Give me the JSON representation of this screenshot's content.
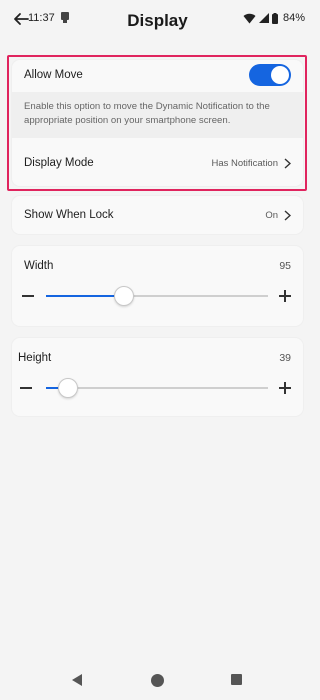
{
  "status_bar": {
    "time": "11:37",
    "battery": "84%"
  },
  "header": {
    "title": "Display"
  },
  "allow_move": {
    "label": "Allow Move",
    "enabled": true,
    "description": "Enable this option to move the Dynamic Notification to the appropriate position on your smartphone screen."
  },
  "display_mode": {
    "label": "Display Mode",
    "value": "Has Notification"
  },
  "show_when_lock": {
    "label": "Show When Lock",
    "value": "On"
  },
  "width_slider": {
    "label": "Width",
    "value": "95",
    "fraction": 0.35
  },
  "height_slider": {
    "label": "Height",
    "value": "39",
    "fraction": 0.1
  },
  "colors": {
    "accent": "#1565e0",
    "highlight": "#e0245e",
    "background": "#f4f4f4"
  },
  "icons": {
    "back": "arrow-left-icon",
    "notification": "notification-icon",
    "wifi": "wifi-icon",
    "signal": "signal-icon",
    "battery": "battery-icon",
    "chevron": "chevron-right-icon",
    "minus": "minus-icon",
    "plus": "plus-icon",
    "nav_back": "nav-back-icon",
    "nav_home": "nav-home-icon",
    "nav_recents": "nav-recents-icon"
  }
}
